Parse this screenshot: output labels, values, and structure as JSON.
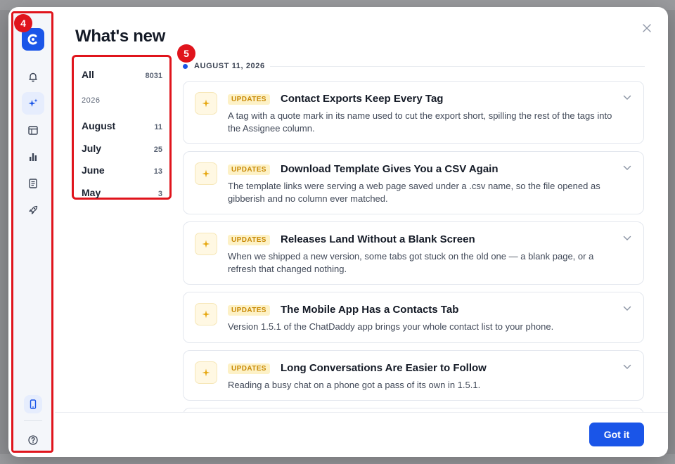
{
  "title": "What's new",
  "annotations": {
    "rail_badge": "4",
    "filter_badge": "5"
  },
  "rail": {
    "logo_icon": "chatdaddy-logo-icon",
    "items": [
      {
        "name": "notifications",
        "icon": "bell-icon",
        "active": false
      },
      {
        "name": "whats-new",
        "icon": "sparkles-icon",
        "active": true
      },
      {
        "name": "calendar",
        "icon": "calendar-icon",
        "active": false
      },
      {
        "name": "analytics",
        "icon": "bar-chart-icon",
        "active": false
      },
      {
        "name": "docs",
        "icon": "document-icon",
        "active": false
      },
      {
        "name": "launch",
        "icon": "rocket-icon",
        "active": false
      }
    ],
    "bottom": [
      {
        "name": "mobile",
        "icon": "phone-icon"
      },
      {
        "name": "help",
        "icon": "question-icon"
      }
    ]
  },
  "filter": {
    "all": {
      "label": "All",
      "count": "8031"
    },
    "year": "2026",
    "months": [
      {
        "label": "August",
        "count": "11"
      },
      {
        "label": "July",
        "count": "25"
      },
      {
        "label": "June",
        "count": "13"
      },
      {
        "label": "May",
        "count": "3"
      }
    ]
  },
  "feed": {
    "date": "AUGUST 11, 2026",
    "entries": [
      {
        "tag": "UPDATES",
        "title": "Contact Exports Keep Every Tag",
        "description": "A tag with a quote mark in its name used to cut the export short, spilling the rest of the tags into the Assignee column."
      },
      {
        "tag": "UPDATES",
        "title": "Download Template Gives You a CSV Again",
        "description": "The template links were serving a web page saved under a .csv name, so the file opened as gibberish and no column ever matched."
      },
      {
        "tag": "UPDATES",
        "title": "Releases Land Without a Blank Screen",
        "description": "When we shipped a new version, some tabs got stuck on the old one — a blank page, or a refresh that changed nothing."
      },
      {
        "tag": "UPDATES",
        "title": "The Mobile App Has a Contacts Tab",
        "description": "Version 1.5.1 of the ChatDaddy app brings your whole contact list to your phone."
      },
      {
        "tag": "UPDATES",
        "title": "Long Conversations Are Easier to Follow",
        "description": "Reading a busy chat on a phone got a pass of its own in 1.5.1."
      }
    ]
  },
  "footer": {
    "button_label": "Got it"
  },
  "colors": {
    "accent": "#1a55e8",
    "annotation": "#e0141c",
    "tag_bg": "#fdf1c6",
    "tag_text": "#c98a06"
  }
}
